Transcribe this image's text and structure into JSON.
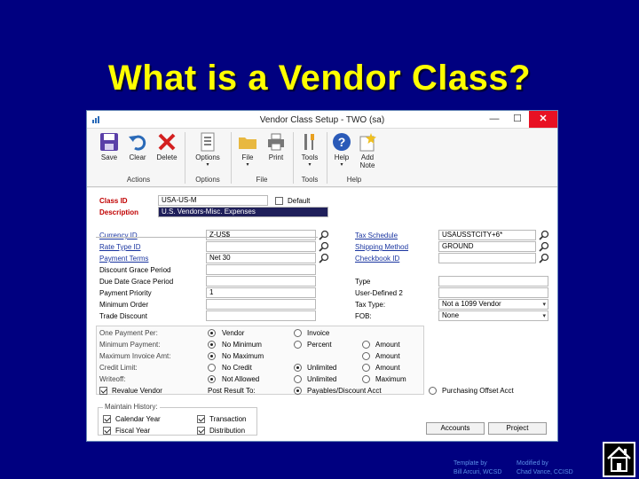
{
  "slide": {
    "title": "What is a Vendor Class?",
    "footer_left_line1": "Template by",
    "footer_left_line2": "Bill Arcuri, WCSD",
    "footer_right_line1": "Modified by",
    "footer_right_line2": "Chad Vance, CCISD",
    "home_icon": "home-icon"
  },
  "window": {
    "title": "Vendor Class Setup  -  TWO (sa)",
    "minimize": "—",
    "maximize": "☐",
    "close": "✕"
  },
  "ribbon": {
    "save": "Save",
    "clear": "Clear",
    "delete": "Delete",
    "options": "Options",
    "file": "File",
    "print": "Print",
    "tools": "Tools",
    "help": "Help",
    "add": "Add",
    "note": "Note",
    "caret": "▾",
    "group_actions": "Actions",
    "group_options": "Options",
    "group_file": "File",
    "group_tools": "Tools",
    "group_help": "Help"
  },
  "form": {
    "class_id_label": "Class ID",
    "class_id_value": "USA-US-M",
    "default_label": "Default",
    "default_checked": false,
    "description_label": "Description",
    "description_value": "U.S. Vendors-Misc. Expenses",
    "currency_id_label": "Currency ID",
    "currency_id_value": "Z-US$",
    "rate_type_id_label": "Rate Type ID",
    "rate_type_id_value": "",
    "payment_terms_label": "Payment Terms",
    "payment_terms_value": "Net 30",
    "discount_grace_label": "Discount Grace Period",
    "due_date_grace_label": "Due Date Grace Period",
    "payment_priority_label": "Payment Priority",
    "payment_priority_value": "1",
    "minimum_order_label": "Minimum Order",
    "trade_discount_label": "Trade Discount",
    "tax_schedule_label": "Tax Schedule",
    "tax_schedule_value": "USAUSSTCITY+6*",
    "shipping_method_label": "Shipping Method",
    "shipping_method_value": "GROUND",
    "checkbook_id_label": "Checkbook ID",
    "checkbook_id_value": "",
    "type_label": "Type",
    "user_defined_label": "User-Defined 2",
    "tax_type_label": "Tax Type:",
    "tax_type_value": "Not a 1099 Vendor",
    "fob_label": "FOB:",
    "fob_value": "None",
    "one_payment_per_label": "One Payment Per:",
    "vendor_option": "Vendor",
    "invoice_option": "Invoice",
    "minimum_payment_label": "Minimum Payment:",
    "no_minimum_option": "No Minimum",
    "percent_option": "Percent",
    "amount_option": "Amount",
    "maximum_invoice_label": "Maximum Invoice Amt:",
    "no_maximum_option": "No Maximum",
    "credit_limit_label": "Credit Limit:",
    "no_credit_option": "No Credit",
    "unlimited_option": "Unlimited",
    "writeoff_label": "Writeoff:",
    "not_allowed_option": "Not Allowed",
    "maximum_option": "Maximum",
    "revalue_vendor_label": "Revalue Vendor",
    "revalue_checked": true,
    "post_result_to_label": "Post Result To:",
    "payables_discount_option": "Payables/Discount Acct",
    "purchasing_offset_option": "Purchasing Offset Acct",
    "maintain_history_label": "Maintain History:",
    "calendar_year_label": "Calendar Year",
    "transaction_label": "Transaction",
    "fiscal_year_label": "Fiscal Year",
    "distribution_label": "Distribution",
    "accounts_button": "Accounts",
    "project_button": "Project"
  },
  "colors": {
    "background": "#000080",
    "title": "#ffff00",
    "required_label": "#c00000",
    "link_label": "#1a35a0"
  }
}
